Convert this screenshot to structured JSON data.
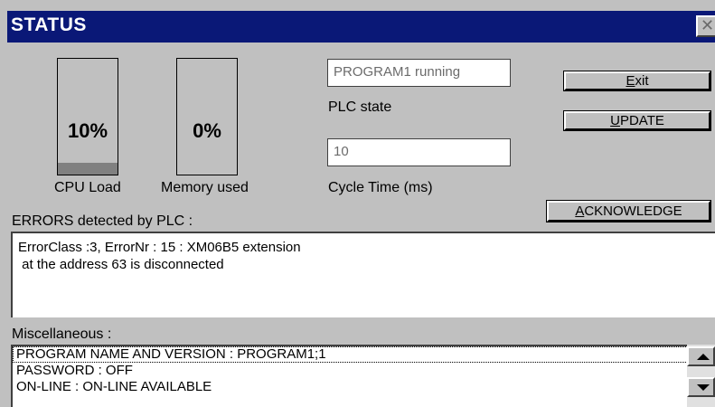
{
  "window": {
    "title": "STATUS",
    "close_glyph": "✕"
  },
  "cpu": {
    "value_text": "10%",
    "level": 0.1,
    "label": "CPU Load"
  },
  "memory": {
    "value_text": "0%",
    "level": 0,
    "label": "Memory used"
  },
  "plc": {
    "state_value": "PROGRAM1 running",
    "state_label": "PLC state",
    "cycle_value": "10",
    "cycle_label": "Cycle Time (ms)"
  },
  "buttons": {
    "exit": {
      "accel": "E",
      "rest": "xit"
    },
    "update": {
      "accel": "U",
      "rest": "PDATE"
    },
    "acknowledge": {
      "accel": "A",
      "rest": "CKNOWLEDGE"
    }
  },
  "errors": {
    "label": "ERRORS detected by PLC :",
    "lines": [
      "ErrorClass :3, ErrorNr : 15 : XM06B5 extension",
      " at the address 63 is disconnected"
    ]
  },
  "misc": {
    "label": "Miscellaneous :",
    "items": [
      "PROGRAM NAME AND VERSION : PROGRAM1;1",
      "PASSWORD : OFF",
      "ON-LINE : ON-LINE AVAILABLE"
    ],
    "selected_index": 0
  },
  "icons": {
    "close": "close-icon",
    "scroll_up": "scroll-up-arrow-icon",
    "scroll_down": "scroll-down-arrow-icon"
  },
  "colors": {
    "titlebar": "#0a1877",
    "face": "#c0c0c0",
    "meter_fill": "#808080"
  }
}
